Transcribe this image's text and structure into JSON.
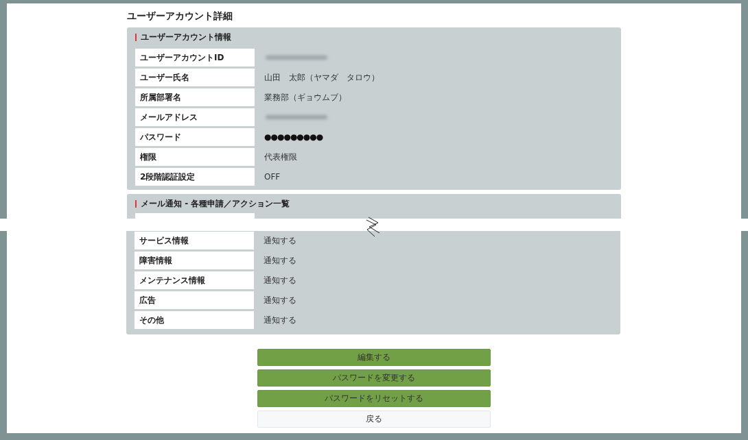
{
  "page": {
    "title": "ユーザーアカウント詳細"
  },
  "account_section": {
    "title": "ユーザーアカウント情報",
    "rows": [
      {
        "label": "ユーザーアカウントID",
        "kind": "redacted"
      },
      {
        "label": "ユーザー氏名",
        "kind": "text",
        "value": "山田　太郎（ヤマダ　タロウ）"
      },
      {
        "label": "所属部署名",
        "kind": "text",
        "value": "業務部（ギョウムブ）"
      },
      {
        "label": "メールアドレス",
        "kind": "redacted"
      },
      {
        "label": "パスワード",
        "kind": "password",
        "value": "●●●●●●●●●"
      },
      {
        "label": "権限",
        "kind": "text",
        "value": "代表権限"
      },
      {
        "label": "2段階認証設定",
        "kind": "text",
        "value": "OFF"
      }
    ]
  },
  "notification_section": {
    "title": "メール通知 - 各種申請／アクション一覧",
    "row_cut_by_break": true,
    "rows_below_break": [
      {
        "label": "サービス情報",
        "value": "通知する"
      },
      {
        "label": "障害情報",
        "value": "通知する"
      },
      {
        "label": "メンテナンス情報",
        "value": "通知する"
      },
      {
        "label": "広告",
        "value": "通知する"
      },
      {
        "label": "その他",
        "value": "通知する"
      }
    ]
  },
  "buttons": [
    {
      "label": "編集する",
      "kind": "primary"
    },
    {
      "label": "パスワードを変更する",
      "kind": "primary"
    },
    {
      "label": "パスワードをリセットする",
      "kind": "primary"
    },
    {
      "label": "戻る",
      "kind": "secondary"
    }
  ]
}
